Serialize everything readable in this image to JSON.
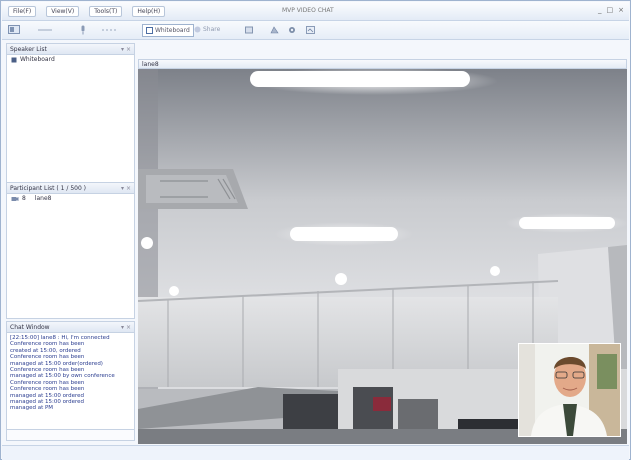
{
  "window": {
    "title": "MVP VIDEO CHAT"
  },
  "menu": [
    "File(F)",
    "View(V)",
    "Tools(T)",
    "Help(H)"
  ],
  "toolbar": {
    "items": [
      "Whiteboard",
      "Share",
      "Record",
      "Snapshot",
      "Settings",
      "Invite",
      "Options"
    ],
    "window_controls": [
      "_",
      "□",
      "×"
    ]
  },
  "panels": {
    "speaker_list": {
      "title": "Speaker List",
      "items": [
        "Whiteboard"
      ]
    },
    "participant_list": {
      "title": "Participant List ( 1 / 500 )",
      "items": [
        {
          "name": "lane8",
          "flag": "8"
        }
      ]
    },
    "chat_window": {
      "title": "Chat Window",
      "lines": [
        "[22:15:00] lane8 : Hi, I'm connected",
        "Conference room has been",
        "created at 15:00, ordered",
        "Conference room has been",
        "managed at 15:00 order(ordered)",
        "Conference room has been",
        "managed at 15:00 by own conference",
        "Conference room has been",
        "Conference room has been",
        "managed at 15:00 ordered",
        "managed at 15:00 ordered",
        "managed at PM"
      ]
    }
  },
  "video": {
    "tab_label": "lane8"
  },
  "colors": {
    "accent": "#2a3c8f",
    "frame": "#9fb3cf",
    "panel_bg": "#ffffff"
  }
}
